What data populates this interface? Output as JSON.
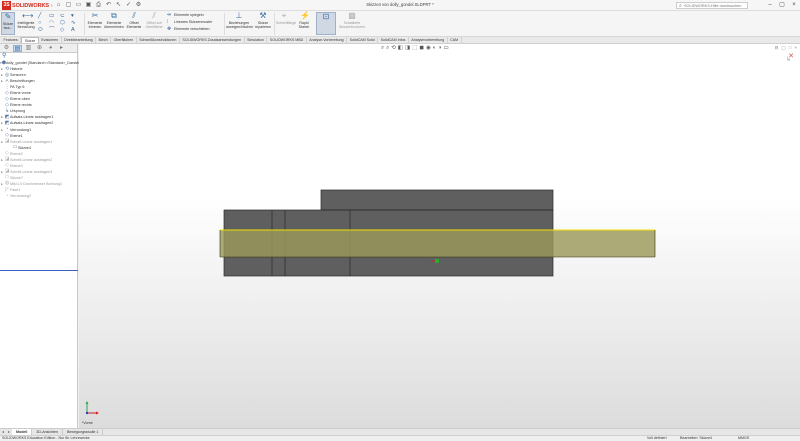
{
  "app": {
    "brand": "SOLIDWORKS",
    "doc_title": "Skizze4 von dolly_gondel.SLDPRT *",
    "search_placeholder": "SOLIDWORKS-Hilfe durchsuchen"
  },
  "ribbon": {
    "exit_sketch": "Skizze bea...",
    "smart_dim": "Intelligente Bemaßung",
    "trim": "Elemente trimmen",
    "convert": "Elemente übernehmen",
    "offset": "Offset Elemente",
    "offset_surface": "Offset auf Oberfläche",
    "mirror": "Elemente spiegeln",
    "linear_pattern": "Lineares Skizzenmuster",
    "move": "Elemente verschieben",
    "relations": "Beziehungen anzeigen/löschen",
    "repair": "Skizze reparieren",
    "quick_snaps": "Schnellfänge",
    "rapid_sketch": "Rapid Sketch",
    "shaded_contours": "Schattierte Skizzenkonturen"
  },
  "cmdtabs": [
    "Features",
    "Skizze",
    "Evaluieren",
    "Direktbearbeitung",
    "Blech",
    "Oberflächen",
    "Schweißkonstruktionen",
    "SOLIDWORKS Zusatzanwendungen",
    "Simulation",
    "SOLIDWORKS MBD",
    "Analyse-Vorbereitung",
    "SolidCAM Solid",
    "SolidCAM Infos",
    "Analysevorbereitung",
    "CAM"
  ],
  "tree": {
    "root": "dolly_gondel (Standard<<Standard>_Darstellung",
    "items": [
      {
        "label": "Historie",
        "icon": "history-icon",
        "supp": false
      },
      {
        "label": "Sensoren",
        "icon": "sensor-icon",
        "supp": false
      },
      {
        "label": "Beschriftungen",
        "icon": "annotation-icon",
        "supp": false
      },
      {
        "label": "PA Typ 6",
        "icon": "material-icon",
        "supp": false
      },
      {
        "label": "Ebene vorne",
        "icon": "plane-icon",
        "supp": false
      },
      {
        "label": "Ebene oben",
        "icon": "plane-icon",
        "supp": false
      },
      {
        "label": "Ebene rechts",
        "icon": "plane-icon",
        "supp": false
      },
      {
        "label": "Ursprung",
        "icon": "origin-icon",
        "supp": false
      },
      {
        "label": "Aufsatz-Linear austragen1",
        "icon": "extrude-icon",
        "supp": false
      },
      {
        "label": "Aufsatz-Linear austragen2",
        "icon": "extrude-icon",
        "supp": false
      },
      {
        "label": "Verrundung1",
        "icon": "fillet-icon",
        "supp": false
      },
      {
        "label": "Ebene1",
        "icon": "plane-icon",
        "supp": false
      },
      {
        "label": "Schnitt-Linear austragen1",
        "icon": "cut-icon",
        "supp": true
      },
      {
        "label": "Skizze4",
        "icon": "sketch-icon",
        "supp": false
      },
      {
        "label": "Ebene2",
        "icon": "plane-icon",
        "supp": true
      },
      {
        "label": "Schnitt-Linear austragen2",
        "icon": "cut-icon",
        "supp": true
      },
      {
        "label": "Ebene3",
        "icon": "plane-icon",
        "supp": true
      },
      {
        "label": "Schnitt-Linear austragen3",
        "icon": "cut-icon",
        "supp": true
      },
      {
        "label": "Skizze7",
        "icon": "sketch-icon",
        "supp": true
      },
      {
        "label": "M6x1.0 Durchmesser Bohrung1",
        "icon": "hole-icon",
        "supp": true
      },
      {
        "label": "Fase1",
        "icon": "chamfer-icon",
        "supp": true
      },
      {
        "label": "Verrundung2",
        "icon": "fillet-icon",
        "supp": true
      }
    ]
  },
  "viewport": {
    "sketch_label": "*Vorne",
    "colors": {
      "part": "#5f5f5f",
      "part_edge": "#2b2b2b",
      "sketch_rect": "#9b9a5a",
      "sketch_line": "#f2e000"
    }
  },
  "bottomtabs": [
    "Modell",
    "3D-Ansichten",
    "Bewegungsstudie 1"
  ],
  "status": {
    "left": "SOLIDWORKS Education Edition - Nur für Lehrzwecke",
    "state": "Voll definiert",
    "editing": "Bearbeiten: Skizze4",
    "units": "MMGS"
  }
}
